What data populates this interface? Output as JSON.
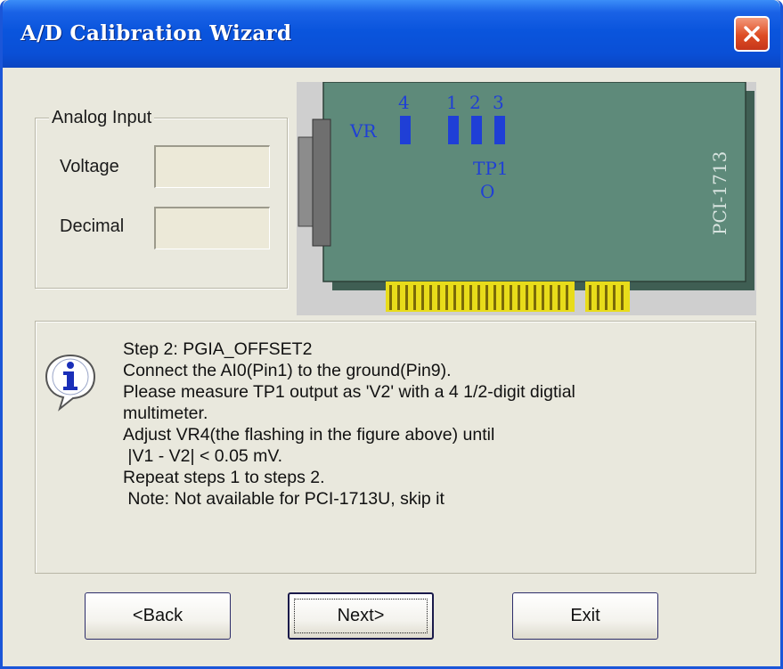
{
  "window": {
    "title": "A/D Calibration Wizard"
  },
  "analog_input": {
    "group_label": "Analog Input",
    "voltage_label": "Voltage",
    "voltage_value": "",
    "decimal_label": "Decimal",
    "decimal_value": ""
  },
  "board": {
    "vr_label": "VR",
    "pins": [
      "4",
      "1",
      "2",
      "3"
    ],
    "tp_label": "TP1",
    "tp_marker": "O",
    "model": "PCI-1713",
    "colors": {
      "board": "#5e8a7a",
      "pin": "#1f3fd6",
      "gold": "#e8dc1a"
    }
  },
  "instructions": {
    "icon": "info-icon",
    "text": "Step 2: PGIA_OFFSET2\nConnect the AI0(Pin1) to the ground(Pin9).\nPlease measure TP1 output as 'V2' with a 4 1/2-digit digtial\nmultimeter.\nAdjust VR4(the flashing in the figure above) until\n |V1 - V2| < 0.05 mV.\nRepeat steps 1 to steps 2.\n Note: Not available for PCI-1713U, skip it"
  },
  "buttons": {
    "back": "<Back",
    "next": "Next>",
    "exit": "Exit"
  }
}
